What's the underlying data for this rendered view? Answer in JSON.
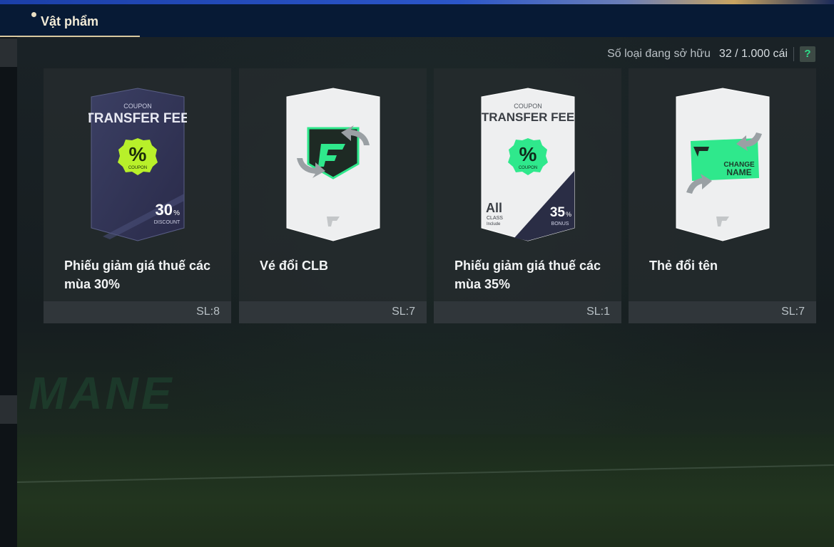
{
  "header": {
    "tab_label": "Vật phẩm"
  },
  "inventory": {
    "count_label": "Số loại đang sở hữu",
    "count_value": "32 / 1.000 cái",
    "help_label": "?"
  },
  "background": {
    "logo_text": "MANE"
  },
  "items": [
    {
      "name": "Phiếu giảm giá thuế các mùa 30%",
      "qty": "SL:8",
      "card_top": "COUPON",
      "card_title": "TRANSFER FEE",
      "badge_symbol": "%",
      "badge_text": "COUPON",
      "value": "30",
      "value_unit": "%",
      "value_caption": "DISCOUNT",
      "style": "dark"
    },
    {
      "name": "Vé đổi CLB",
      "qty": "SL:7",
      "style": "club"
    },
    {
      "name": "Phiếu giảm giá thuế các mùa 35%",
      "qty": "SL:1",
      "card_top": "COUPON",
      "card_title": "TRANSFER FEE",
      "badge_symbol": "%",
      "badge_text": "COUPON",
      "class_big": "All",
      "class_small": "CLASS",
      "class_small2": "Include",
      "value": "35",
      "value_unit": "%",
      "value_caption": "BONUS",
      "style": "light"
    },
    {
      "name": "Thẻ đổi tên",
      "qty": "SL:7",
      "ticket_line1": "CHANGE",
      "ticket_line2": "NAME",
      "style": "name"
    }
  ],
  "colors": {
    "accent_green": "#2fe88c",
    "lime_badge": "#b8f02a",
    "header_bg": "#071a35",
    "tab_underline": "#d9c9a0"
  }
}
